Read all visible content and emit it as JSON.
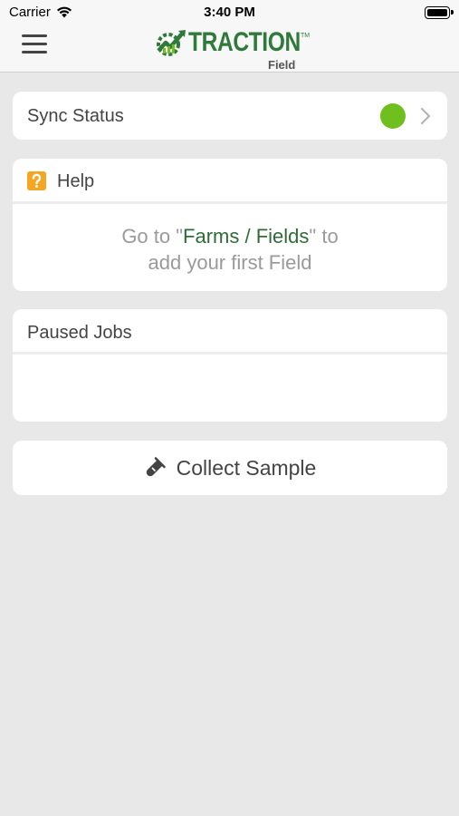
{
  "status_bar": {
    "carrier": "Carrier",
    "time": "3:40 PM"
  },
  "navbar": {
    "logo_word": "TRACTION",
    "logo_tm": "TM",
    "logo_sub": "Field"
  },
  "sync": {
    "label": "Sync Status",
    "status_color": "#6fbf1e"
  },
  "help": {
    "title": "Help",
    "line1_prefix": "Go to \"",
    "link_text": "Farms / Fields",
    "line1_suffix": "\" to",
    "line2": "add your first Field"
  },
  "paused_jobs": {
    "title": "Paused Jobs"
  },
  "collect": {
    "label": "Collect Sample"
  },
  "colors": {
    "brand_green": "#2f7a3a",
    "link_green": "#2f6b37",
    "status_green": "#6fbf1e",
    "help_orange": "#f5a623",
    "background": "#e8e8e8"
  }
}
